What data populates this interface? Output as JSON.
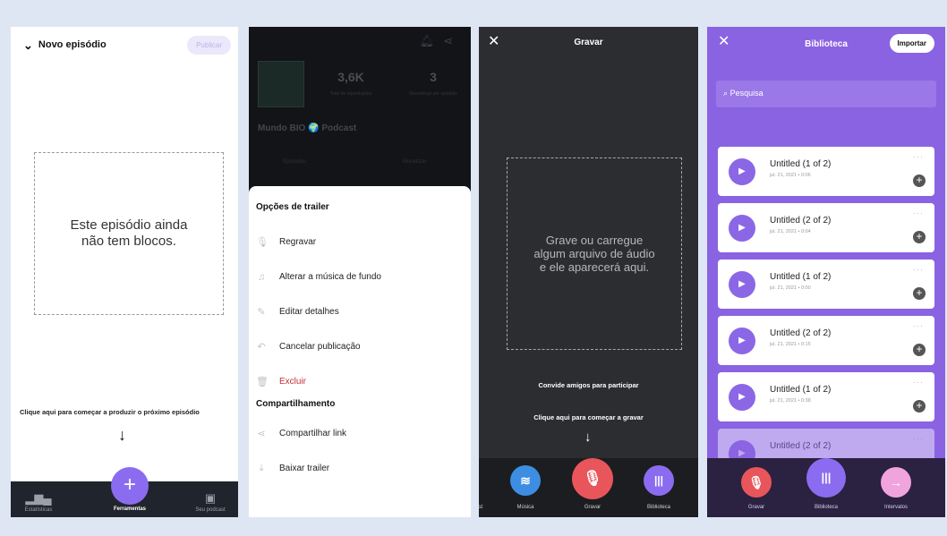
{
  "screen1": {
    "header_title": "Novo episódio",
    "publish_label": "Publicar",
    "empty_state": "Este episódio ainda não tem blocos.",
    "hint": "Clique aqui para começar a produzir o próximo episódio",
    "nav": [
      {
        "label": "Estatísticas"
      },
      {
        "label": "Ferramentas"
      },
      {
        "label": "Seu podcast"
      }
    ]
  },
  "screen2": {
    "plays_value": "3,6K",
    "plays_label": "Total de reproduções",
    "streams_value": "3",
    "streams_label": "Streamings por episódio",
    "podcast_name": "Mundo BIO 🌍 Podcast",
    "tabs": [
      "Episódios",
      "Monetizar"
    ],
    "trailer_section": "Opções de trailer",
    "trailer_options": [
      {
        "label": "Regravar"
      },
      {
        "label": "Alterar a música de fundo"
      },
      {
        "label": "Editar detalhes"
      },
      {
        "label": "Cancelar publicação"
      },
      {
        "label": "Excluir"
      }
    ],
    "share_section": "Compartilhamento",
    "share_options": [
      {
        "label": "Compartilhar link"
      },
      {
        "label": "Baixar trailer"
      }
    ]
  },
  "screen3": {
    "title": "Gravar",
    "empty_state": "Grave ou carregue algum arquivo de áudio e ele aparecerá aqui.",
    "invite": "Convide amigos para participar",
    "record_hint": "Clique aqui para começar a gravar",
    "bar": [
      {
        "label": "voz"
      },
      {
        "label": "Música"
      },
      {
        "label": "Gravar"
      },
      {
        "label": "Biblioteca"
      }
    ]
  },
  "screen4": {
    "title": "Biblioteca",
    "import_label": "Importar",
    "search_placeholder": "Pesquisa",
    "items": [
      {
        "title": "Untitled (1 of 2)",
        "meta": "jul. 21, 2021 • 0:06"
      },
      {
        "title": "Untitled (2 of 2)",
        "meta": "jul. 21, 2021 • 0:04"
      },
      {
        "title": "Untitled (1 of 2)",
        "meta": "jul. 21, 2021 • 0:00"
      },
      {
        "title": "Untitled (2 of 2)",
        "meta": "jul. 21, 2021 • 0:15"
      },
      {
        "title": "Untitled (1 of 2)",
        "meta": "jul. 21, 2021 • 0:38"
      },
      {
        "title": "Untitled (2 of 2)",
        "meta": ""
      }
    ],
    "bar": [
      {
        "label": "Gravar"
      },
      {
        "label": "Biblioteca"
      },
      {
        "label": "Intervalos"
      }
    ]
  },
  "colors": {
    "accent_purple": "#8b6cf0",
    "record_red": "#e8565b",
    "spotify_blue": "#3d8ee3",
    "danger": "#c7303c",
    "page_bg": "#dfe6f3"
  }
}
